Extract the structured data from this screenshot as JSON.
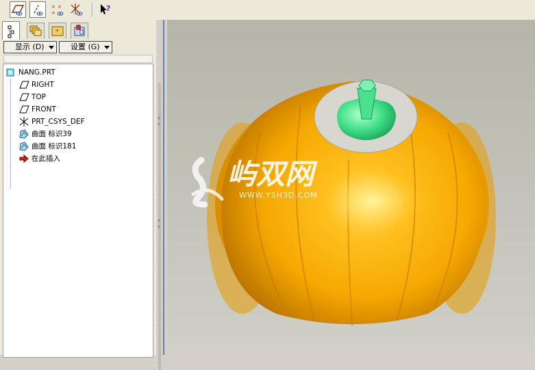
{
  "toolbar": {
    "buttons": [
      {
        "name": "datum-plane-display-icon",
        "active": true
      },
      {
        "name": "datum-axis-display-icon",
        "active": true
      },
      {
        "name": "datum-point-display-icon",
        "active": false
      },
      {
        "name": "coordinate-system-display-icon",
        "active": false
      }
    ],
    "help_icon": "context-help-icon"
  },
  "tabs": [
    {
      "name": "model-tree-tab",
      "active": true
    },
    {
      "name": "folder-browser-tab",
      "active": false
    },
    {
      "name": "favorites-tab",
      "active": false
    },
    {
      "name": "connections-tab",
      "active": false
    }
  ],
  "dropdowns": {
    "show_label": "显示 (D)",
    "settings_label": "设置 (G)"
  },
  "tree": {
    "root": "NANG.PRT",
    "items": [
      {
        "label": "RIGHT",
        "icon": "datum-plane-icon"
      },
      {
        "label": "TOP",
        "icon": "datum-plane-icon"
      },
      {
        "label": "FRONT",
        "icon": "datum-plane-icon"
      },
      {
        "label": "PRT_CSYS_DEF",
        "icon": "coordinate-system-icon"
      },
      {
        "label": "曲面 标识39",
        "icon": "surface-icon"
      },
      {
        "label": "曲面 标识181",
        "icon": "surface-icon"
      },
      {
        "label": "在此插入",
        "icon": "insert-here-arrow-icon"
      }
    ]
  },
  "watermark": {
    "brand": "屿双网",
    "url": "WWW.YSH3D.COM"
  },
  "colors": {
    "model_orange": "#f5a800",
    "stem_green": "#3ddc84",
    "background_gray": "#c3c2b8",
    "accent_blue": "#2040a0"
  }
}
